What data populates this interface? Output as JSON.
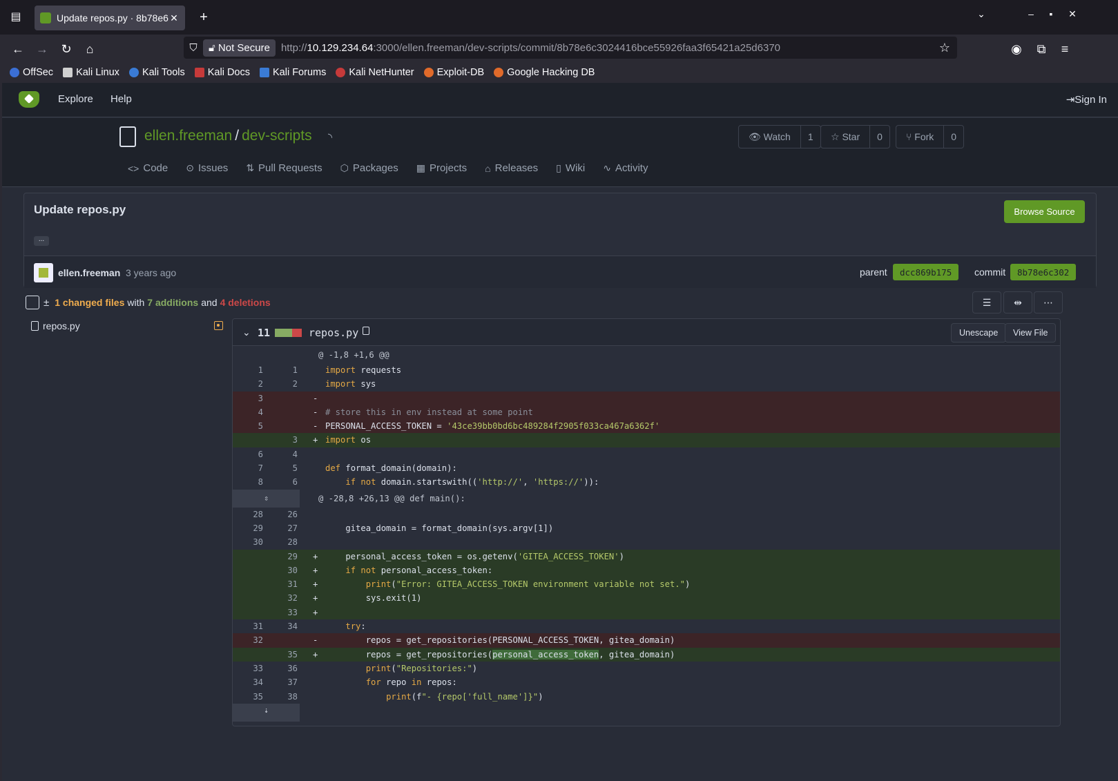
{
  "browser": {
    "tab_title": "Update repos.py · 8b78e6",
    "new_tab": "+",
    "not_secure": "Not Secure",
    "url_prefix": "http://",
    "url_host": "10.129.234.64",
    "url_rest": ":3000/ellen.freeman/dev-scripts/commit/8b78e6c3024416bce55926faa3f65421a25d6370",
    "bookmarks": [
      "OffSec",
      "Kali Linux",
      "Kali Tools",
      "Kali Docs",
      "Kali Forums",
      "Kali NetHunter",
      "Exploit-DB",
      "Google Hacking DB"
    ]
  },
  "gitea_nav": {
    "explore": "Explore",
    "help": "Help",
    "sign_in": "Sign In"
  },
  "repo": {
    "owner": "ellen.freeman",
    "separator": "/",
    "name": "dev-scripts",
    "watch": "Watch",
    "watch_count": "1",
    "star": "Star",
    "star_count": "0",
    "fork": "Fork",
    "fork_count": "0",
    "tabs": [
      "Code",
      "Issues",
      "Pull Requests",
      "Packages",
      "Projects",
      "Releases",
      "Wiki",
      "Activity"
    ]
  },
  "commit": {
    "title": "Update repos.py",
    "browse_source": "Browse Source",
    "ellipsis": "...",
    "author": "ellen.freeman",
    "ago": "3 years ago",
    "parent_label": "parent",
    "parent_sha": "dcc869b175",
    "commit_label": "commit",
    "commit_sha": "8b78e6c302"
  },
  "diffstats": {
    "pm": "±",
    "changed": "1 changed files",
    "with": "with",
    "additions": "7 additions",
    "and": "and",
    "deletions": "4 deletions"
  },
  "file": {
    "name": "repos.py",
    "count": "11",
    "unescape": "Unescape",
    "view_file": "View File"
  },
  "diff_lines": [
    {
      "type": "hunk",
      "text": "@ -1,8 +1,6 @@"
    },
    {
      "type": "ctx",
      "o": "1",
      "n": "1",
      "text": "import requests"
    },
    {
      "type": "ctx",
      "o": "2",
      "n": "2",
      "text": "import sys"
    },
    {
      "type": "del",
      "o": "3",
      "n": "",
      "text": ""
    },
    {
      "type": "del",
      "o": "4",
      "n": "",
      "text": "# store this in env instead at some point"
    },
    {
      "type": "del",
      "o": "5",
      "n": "",
      "text": "PERSONAL_ACCESS_TOKEN = '43ce39bb0bd6bc489284f2905f033ca467a6362f'"
    },
    {
      "type": "add",
      "o": "",
      "n": "3",
      "text": "import os"
    },
    {
      "type": "ctx",
      "o": "6",
      "n": "4",
      "text": ""
    },
    {
      "type": "ctx",
      "o": "7",
      "n": "5",
      "text": "def format_domain(domain):"
    },
    {
      "type": "ctx",
      "o": "8",
      "n": "6",
      "text": "    if not domain.startswith(('http://', 'https://')):"
    },
    {
      "type": "hunk",
      "text": "@ -28,8 +26,13 @@ def main():"
    },
    {
      "type": "ctx",
      "o": "28",
      "n": "26",
      "text": ""
    },
    {
      "type": "ctx",
      "o": "29",
      "n": "27",
      "text": "    gitea_domain = format_domain(sys.argv[1])"
    },
    {
      "type": "ctx",
      "o": "30",
      "n": "28",
      "text": ""
    },
    {
      "type": "add",
      "o": "",
      "n": "29",
      "text": "    personal_access_token = os.getenv('GITEA_ACCESS_TOKEN')"
    },
    {
      "type": "add",
      "o": "",
      "n": "30",
      "text": "    if not personal_access_token:"
    },
    {
      "type": "add",
      "o": "",
      "n": "31",
      "text": "        print(\"Error: GITEA_ACCESS_TOKEN environment variable not set.\")"
    },
    {
      "type": "add",
      "o": "",
      "n": "32",
      "text": "        sys.exit(1)"
    },
    {
      "type": "add",
      "o": "",
      "n": "33",
      "text": ""
    },
    {
      "type": "ctx",
      "o": "31",
      "n": "34",
      "text": "    try:"
    },
    {
      "type": "del",
      "o": "32",
      "n": "",
      "text": "        repos = get_repositories(PERSONAL_ACCESS_TOKEN, gitea_domain)"
    },
    {
      "type": "add",
      "o": "",
      "n": "35",
      "text": "        repos = get_repositories(personal_access_token, gitea_domain)"
    },
    {
      "type": "ctx",
      "o": "33",
      "n": "36",
      "text": "        print(\"Repositories:\")"
    },
    {
      "type": "ctx",
      "o": "34",
      "n": "37",
      "text": "        for repo in repos:"
    },
    {
      "type": "ctx",
      "o": "35",
      "n": "38",
      "text": "            print(f\"- {repo['full_name']}\")"
    }
  ],
  "colors": {
    "accent": "#609926",
    "add": "#87ab63",
    "del": "#cc4848",
    "changed": "#f0ad4e"
  }
}
